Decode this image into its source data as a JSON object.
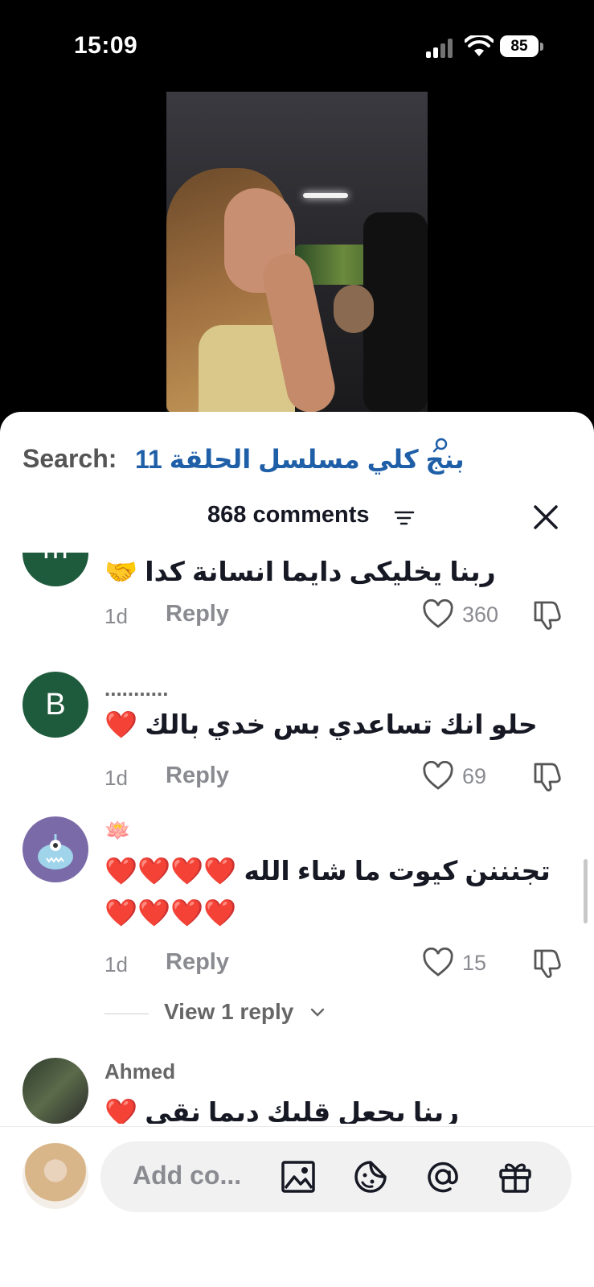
{
  "status_bar": {
    "time": "15:09",
    "battery": "85"
  },
  "search": {
    "prefix": "Search:",
    "query": "بنج كلي مسلسل الحلقة 11"
  },
  "header": {
    "comments_count": "868 comments"
  },
  "comments": [
    {
      "username": "",
      "avatar_letter": "m",
      "avatar_color": "#1e5a3c",
      "text": "ربنا يخليكى دايما انسانة كدا 🤝",
      "time": "1d",
      "reply_label": "Reply",
      "likes": "360"
    },
    {
      "username": "...........",
      "avatar_letter": "B",
      "avatar_color": "#1e5a3c",
      "text": "حلو انك تساعدي بس خدي بالك ❤️",
      "time": "1d",
      "reply_label": "Reply",
      "likes": "69"
    },
    {
      "username": "🪷",
      "avatar_letter": "",
      "avatar_color": "#7a6aa8",
      "text": "تجنننن كيوت ما شاء الله ❤️❤️❤️❤️❤️❤️❤️❤️",
      "time": "1d",
      "reply_label": "Reply",
      "likes": "15",
      "view_replies": "View 1 reply"
    },
    {
      "username": "Ahmed",
      "avatar_letter": "",
      "avatar_color": "#3a4a3a",
      "text": "ربنا يجعل قلبك ديما نقى ❤️"
    }
  ],
  "composer": {
    "placeholder": "Add co..."
  },
  "colors": {
    "accent": "#1f5fa8",
    "text_primary": "#161823",
    "text_secondary": "#8a8b91"
  },
  "icons": [
    "search-icon",
    "filter-icon",
    "close-icon",
    "heart-icon",
    "dislike-icon",
    "chevron-down-icon",
    "image-icon",
    "emoji-icon",
    "mention-icon",
    "gift-icon"
  ]
}
